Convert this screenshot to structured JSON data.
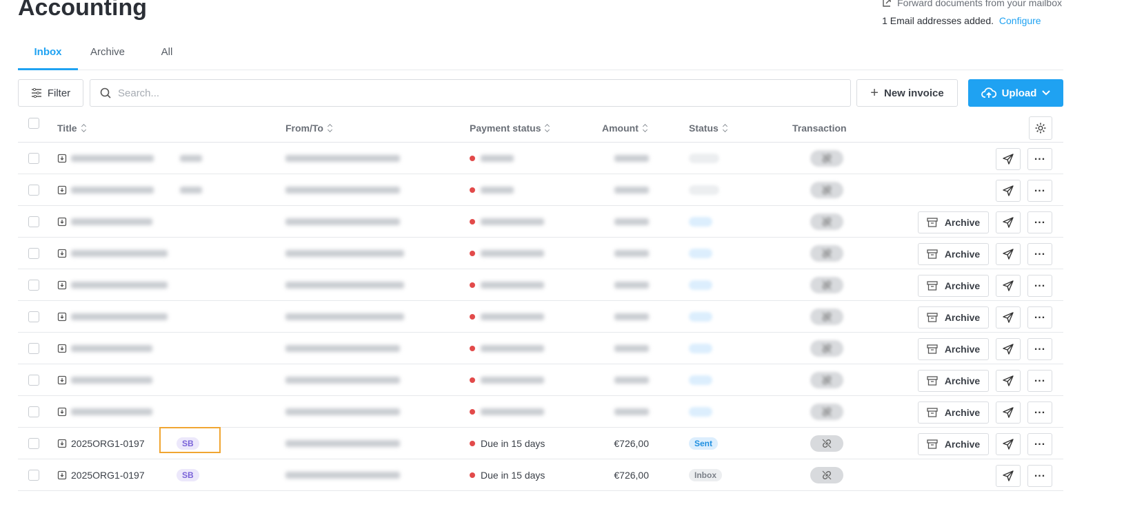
{
  "page": {
    "title": "Accounting",
    "mailbox_forward": "Forward documents from your mailbox",
    "emails_added": "1 Email addresses added.",
    "configure": "Configure"
  },
  "tabs": [
    {
      "label": "Inbox",
      "active": true
    },
    {
      "label": "Archive",
      "active": false
    },
    {
      "label": "All",
      "active": false
    }
  ],
  "toolbar": {
    "filter": "Filter",
    "search_placeholder": "Search...",
    "new_invoice": "New invoice",
    "upload": "Upload"
  },
  "columns": {
    "title": "Title",
    "from_to": "From/To",
    "payment_status": "Payment status",
    "amount": "Amount",
    "status": "Status",
    "transaction": "Transaction"
  },
  "rows": [
    {
      "title": "",
      "tag": "",
      "from": "",
      "payment": "",
      "amount": "",
      "status": "",
      "status_kind": "inbox",
      "archive": false,
      "blurred": true
    },
    {
      "title": "",
      "tag": "",
      "from": "",
      "payment": "",
      "amount": "",
      "status": "",
      "status_kind": "inbox",
      "archive": false,
      "blurred": true
    },
    {
      "title": "",
      "tag": "",
      "from": "",
      "payment": "",
      "amount": "",
      "status": "",
      "status_kind": "sent",
      "archive": true,
      "blurred": true
    },
    {
      "title": "",
      "tag": "",
      "from": "",
      "payment": "",
      "amount": "",
      "status": "",
      "status_kind": "sent",
      "archive": true,
      "blurred": true
    },
    {
      "title": "",
      "tag": "",
      "from": "",
      "payment": "",
      "amount": "",
      "status": "",
      "status_kind": "sent",
      "archive": true,
      "blurred": true
    },
    {
      "title": "",
      "tag": "",
      "from": "",
      "payment": "",
      "amount": "",
      "status": "",
      "status_kind": "sent",
      "archive": true,
      "blurred": true
    },
    {
      "title": "",
      "tag": "",
      "from": "",
      "payment": "",
      "amount": "",
      "status": "",
      "status_kind": "sent",
      "archive": true,
      "blurred": true
    },
    {
      "title": "",
      "tag": "",
      "from": "",
      "payment": "",
      "amount": "",
      "status": "",
      "status_kind": "sent",
      "archive": true,
      "blurred": true
    },
    {
      "title": "",
      "tag": "",
      "from": "",
      "payment": "",
      "amount": "",
      "status": "",
      "status_kind": "sent",
      "archive": true,
      "blurred": true
    },
    {
      "title": "2025ORG1-0197",
      "tag": "SB",
      "from": "",
      "payment": "Due in 15 days",
      "amount": "€726,00",
      "status": "Sent",
      "status_kind": "sent",
      "archive": true,
      "blurred": false
    },
    {
      "title": "2025ORG1-0197",
      "tag": "SB",
      "from": "",
      "payment": "Due in 15 days",
      "amount": "€726,00",
      "status": "Inbox",
      "status_kind": "inbox",
      "archive": false,
      "blurred": false
    }
  ],
  "row_actions": {
    "archive": "Archive"
  },
  "colors": {
    "accent": "#1fa2f2",
    "unpaid_dot": "#e24a4a",
    "highlight": "#f0a531"
  }
}
